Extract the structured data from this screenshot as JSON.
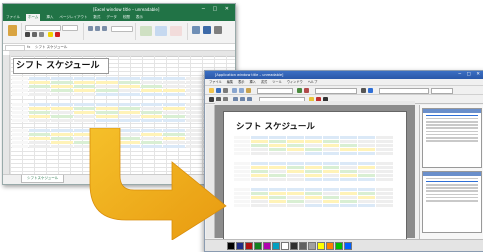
{
  "excel": {
    "title": "[Excel window title – unreadable]",
    "tabs": [
      "ファイル",
      "ホーム",
      "挿入",
      "ページレイアウト",
      "数式",
      "データ",
      "校閲",
      "表示"
    ],
    "active_tab": "ホーム",
    "name_box": "",
    "formula_value": "シフト スケジュール",
    "sheet_title": "シフト スケジュール",
    "sheet_tab": "シフトスケジュール"
  },
  "app2": {
    "title": "[Application window title – unreadable]",
    "menu": [
      "ファイル",
      "編集",
      "表示",
      "挿入",
      "書式",
      "ツール",
      "ウィンドウ",
      "ヘルプ"
    ],
    "sheet_title": "シフト スケジュール"
  },
  "colors": {
    "excel_green": "#217346",
    "arrow_fill": "#f0b21a",
    "header_blue": "#dbe9f7",
    "cell_yellow": "#fff3b8",
    "cell_green": "#d9efd3"
  },
  "icons": [
    "arrow-curved-icon"
  ],
  "palette_colors": [
    "#000000",
    "#1f2d86",
    "#b01010",
    "#12801e",
    "#b000b0",
    "#00a0c0",
    "#ffffff",
    "#303030",
    "#606060",
    "#a0a0a0",
    "#ffff00",
    "#ff8000",
    "#00c000",
    "#0060ff"
  ]
}
